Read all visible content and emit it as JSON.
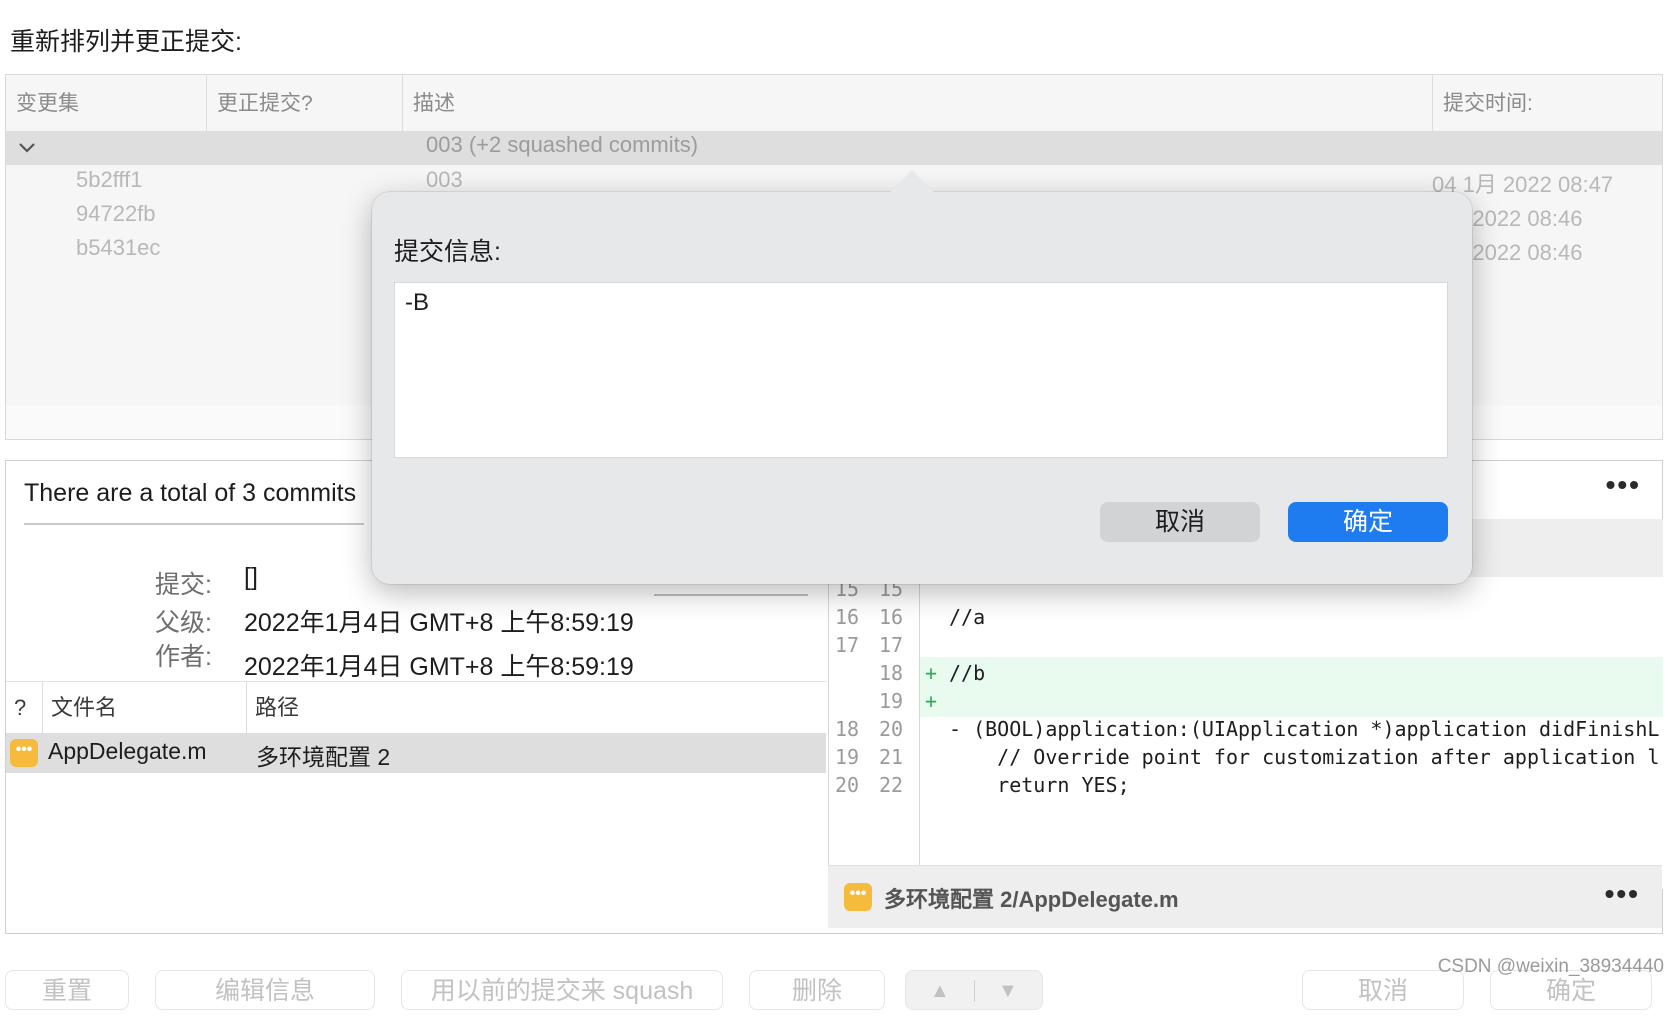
{
  "page_title": "重新排列并更正提交:",
  "table": {
    "columns": [
      "变更集",
      "更正提交?",
      "描述",
      "提交时间:"
    ],
    "group": {
      "description": "003 (+2 squashed commits)"
    },
    "rows": [
      {
        "changeset": "5b2fff1",
        "description": "003",
        "time": "04 1月 2022 08:47"
      },
      {
        "changeset": "94722fb",
        "description": "",
        "time": "1月 2022 08:46"
      },
      {
        "changeset": "b5431ec",
        "description": "",
        "time": "1月 2022 08:46"
      }
    ]
  },
  "details": {
    "summary": "There are a total of 3 commits",
    "commit_label": "提交:",
    "commit_value": "[]",
    "parent_label": "父级:",
    "parent_value": "2022年1月4日 GMT+8 上午8:59:19",
    "author_label": "作者:",
    "author_value": "2022年1月4日 GMT+8 上午8:59:19",
    "more_icon": "•••"
  },
  "files": {
    "columns": [
      "?",
      "文件名",
      "路径"
    ],
    "rows": [
      {
        "badge": "•••",
        "name": "AppDelegate.m",
        "path": "多环境配置 2"
      }
    ]
  },
  "diff": {
    "lines": [
      {
        "old": "15",
        "new": "15",
        "marker": "",
        "text": "",
        "added": false
      },
      {
        "old": "16",
        "new": "16",
        "marker": "",
        "text": "//a",
        "added": false
      },
      {
        "old": "17",
        "new": "17",
        "marker": "",
        "text": "",
        "added": false
      },
      {
        "old": "",
        "new": "18",
        "marker": "+",
        "text": "//b",
        "added": true
      },
      {
        "old": "",
        "new": "19",
        "marker": "+",
        "text": "",
        "added": true
      },
      {
        "old": "18",
        "new": "20",
        "marker": "",
        "text": "- (BOOL)application:(UIApplication *)application didFinishL",
        "added": false
      },
      {
        "old": "19",
        "new": "21",
        "marker": "",
        "text": "    // Override point for customization after application l",
        "added": false
      },
      {
        "old": "20",
        "new": "22",
        "marker": "",
        "text": "    return YES;",
        "added": false
      }
    ],
    "footer_path": "多环境配置 2/AppDelegate.m",
    "footer_badge": "•••",
    "footer_more": "•••",
    "top_more": "•••"
  },
  "toolbar": {
    "reset": "重置",
    "edit_message": "编辑信息",
    "squash": "用以前的提交来 squash",
    "delete": "删除",
    "up": "▲",
    "down": "▼",
    "cancel": "取消",
    "confirm": "确定"
  },
  "watermark": "CSDN @weixin_38934440",
  "popover": {
    "label": "提交信息:",
    "message": "-B",
    "cancel": "取消",
    "ok": "确定"
  },
  "colors": {
    "accent": "#1e7cf0",
    "badge": "#f6bb3c",
    "added_line": "#e9fbee",
    "plus": "#2eaa58"
  }
}
